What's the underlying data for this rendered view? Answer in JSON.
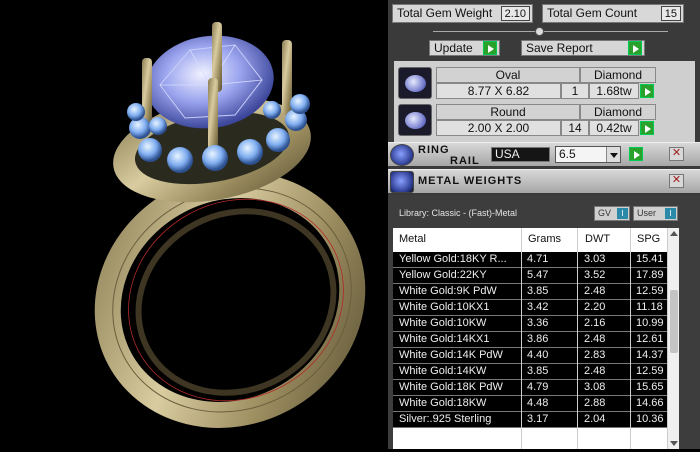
{
  "stats": {
    "total_gem_weight_label": "Total Gem Weight",
    "total_gem_weight_value": "2.10",
    "total_gem_count_label": "Total Gem Count",
    "total_gem_count_value": "15"
  },
  "actions": {
    "update_label": "Update",
    "save_report_label": "Save Report"
  },
  "gems": [
    {
      "shape": "Oval",
      "type": "Diamond",
      "size": "8.77 X 6.82",
      "count": "1",
      "weight": "1.68tw"
    },
    {
      "shape": "Round",
      "type": "Diamond",
      "size": "2.00 X 2.00",
      "count": "14",
      "weight": "0.42tw"
    }
  ],
  "ring_rail": {
    "title_line1": "RING",
    "title_line2": "RAIL",
    "region": "USA",
    "size": "6.5"
  },
  "metal_weights": {
    "title": "METAL WEIGHTS",
    "library": "Library: Classic - (Fast)-Metal",
    "toggle_gv": "GV",
    "toggle_user": "User",
    "toggle_indicator": "I",
    "columns": [
      "Metal",
      "Grams",
      "DWT",
      "SPG"
    ],
    "rows": [
      [
        "Yellow Gold:18KY R...",
        "4.71",
        "3.03",
        "15.41"
      ],
      [
        "Yellow Gold:22KY",
        "5.47",
        "3.52",
        "17.89"
      ],
      [
        "White Gold:9K PdW",
        "3.85",
        "2.48",
        "12.59"
      ],
      [
        "White Gold:10KX1",
        "3.42",
        "2.20",
        "11.18"
      ],
      [
        "White Gold:10KW",
        "3.36",
        "2.16",
        "10.99"
      ],
      [
        "White Gold:14KX1",
        "3.86",
        "2.48",
        "12.61"
      ],
      [
        "White Gold:14K PdW",
        "4.40",
        "2.83",
        "14.37"
      ],
      [
        "White Gold:14KW",
        "3.85",
        "2.48",
        "12.59"
      ],
      [
        "White Gold:18K PdW",
        "4.79",
        "3.08",
        "15.65"
      ],
      [
        "White Gold:18KW",
        "4.48",
        "2.88",
        "14.66"
      ],
      [
        "Silver:.925 Sterling",
        "3.17",
        "2.04",
        "10.36"
      ]
    ]
  },
  "colors": {
    "go_button": "#2aa12a",
    "close_x": "#a02020",
    "metal_band": "#c8b88a",
    "gem_blue": "#8ab0ff"
  }
}
